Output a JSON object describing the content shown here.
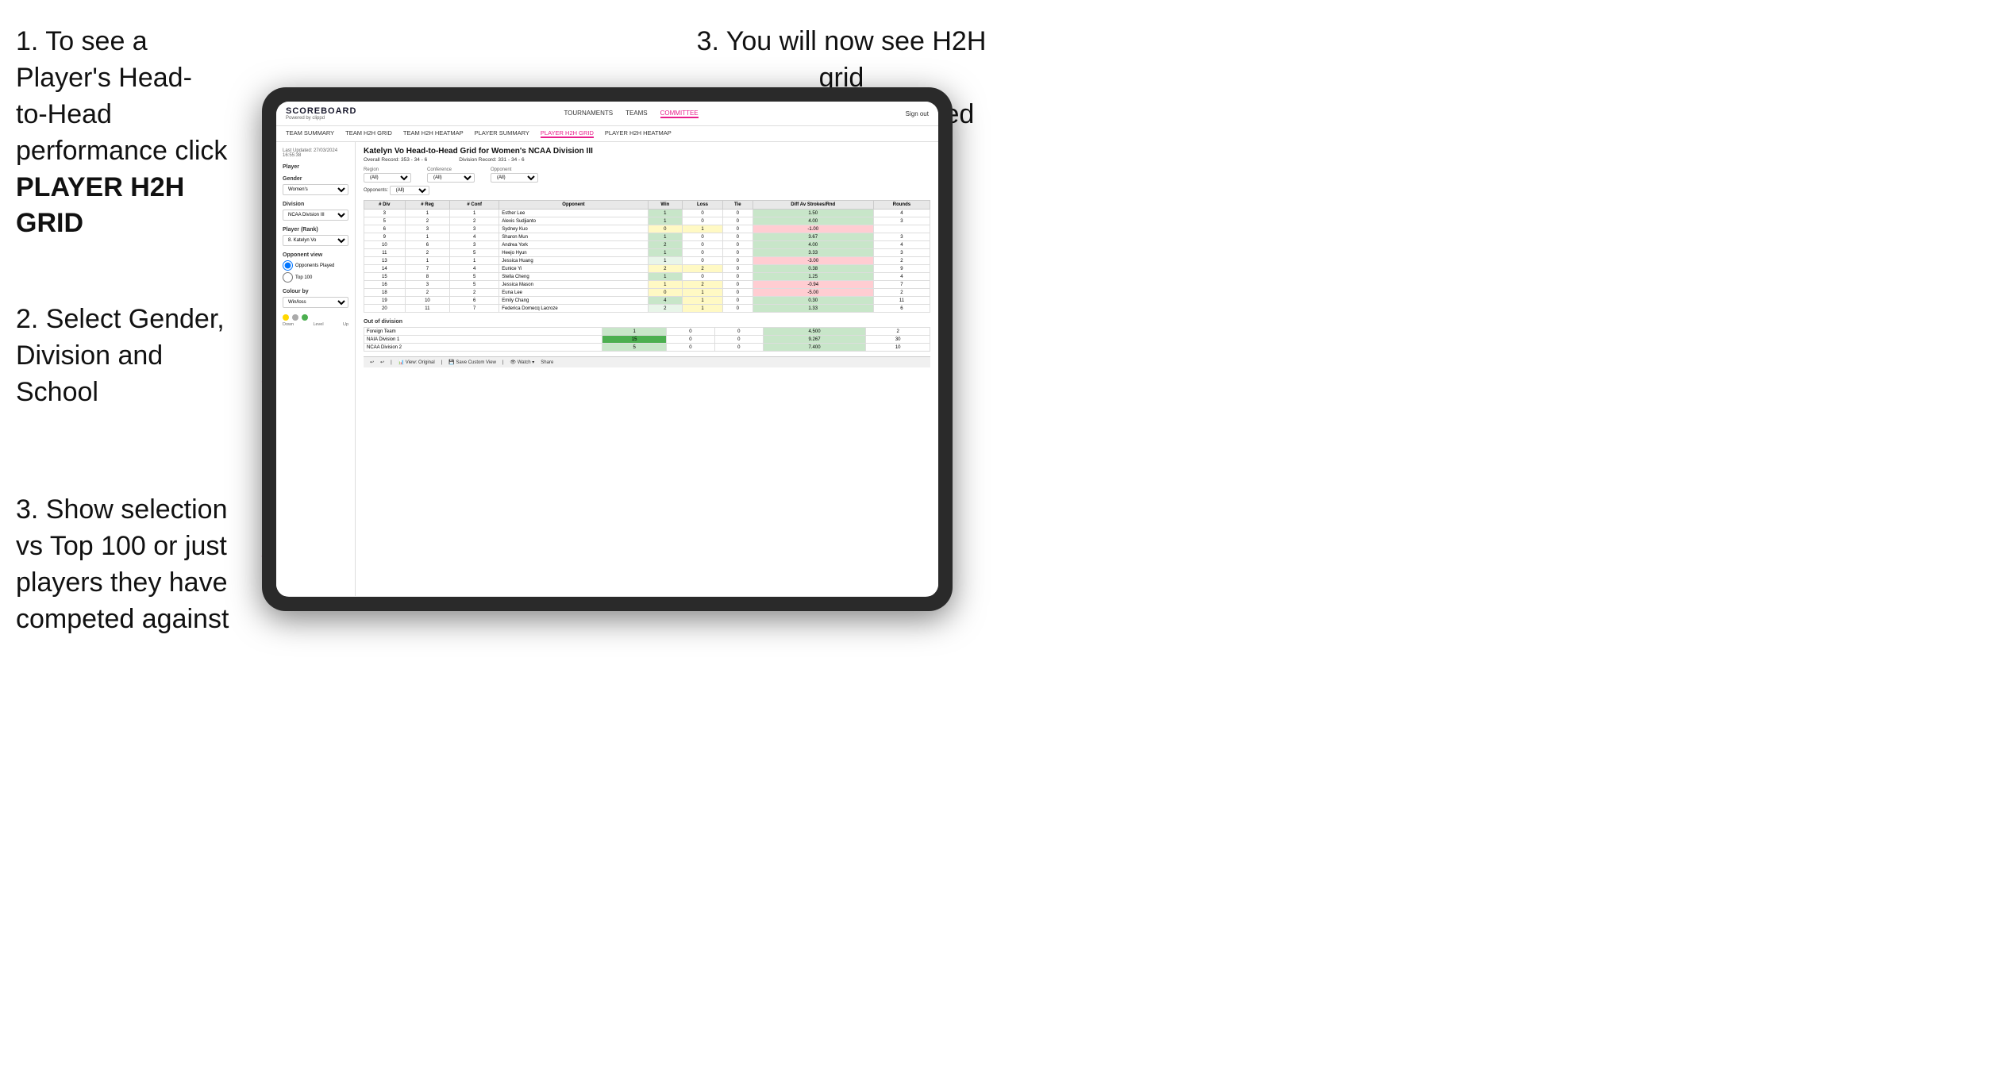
{
  "instructions": {
    "instr1_line1": "1. To see a Player's Head-",
    "instr1_line2": "to-Head performance click",
    "instr1_bold": "PLAYER H2H GRID",
    "instr2_line1": "2. Select Gender,",
    "instr2_line2": "Division and",
    "instr2_line3": "School",
    "instr3_left_line1": "3. Show selection",
    "instr3_left_line2": "vs Top 100 or just",
    "instr3_left_line3": "players they have",
    "instr3_left_line4": "competed against",
    "instr3_top_line1": "3. You will now see H2H grid",
    "instr3_top_line2": "for the player selected"
  },
  "navbar": {
    "brand": "SCOREBOARD",
    "brand_sub": "Powered by clippd",
    "tournaments": "TOURNAMENTS",
    "teams": "TEAMS",
    "committee": "COMMITTEE",
    "sign_out": "Sign out"
  },
  "subnav": {
    "team_summary": "TEAM SUMMARY",
    "team_h2h_grid": "TEAM H2H GRID",
    "team_h2h_heatmap": "TEAM H2H HEATMAP",
    "player_summary": "PLAYER SUMMARY",
    "player_h2h_grid": "PLAYER H2H GRID",
    "player_h2h_heatmap": "PLAYER H2H HEATMAP"
  },
  "left_panel": {
    "last_updated": "Last Updated: 27/03/2024",
    "time": "16:55:38",
    "player_label": "Player",
    "gender_label": "Gender",
    "gender_value": "Women's",
    "division_label": "Division",
    "division_value": "NCAA Division III",
    "player_rank_label": "Player (Rank)",
    "player_rank_value": "8. Katelyn Vo",
    "opponent_view_label": "Opponent view",
    "opponents_played": "Opponents Played",
    "top_100": "Top 100",
    "colour_by_label": "Colour by",
    "colour_by_value": "Win/loss",
    "legend_down": "Down",
    "legend_level": "Level",
    "legend_up": "Up"
  },
  "grid": {
    "title": "Katelyn Vo Head-to-Head Grid for Women's NCAA Division III",
    "overall_record": "Overall Record: 353 - 34 - 6",
    "division_record": "Division Record: 331 - 34 - 6",
    "region_label": "Region",
    "conference_label": "Conference",
    "opponent_label": "Opponent",
    "opponents_label": "Opponents:",
    "all": "(All)",
    "col_div": "# Div",
    "col_reg": "# Reg",
    "col_conf": "# Conf",
    "col_opponent": "Opponent",
    "col_win": "Win",
    "col_loss": "Loss",
    "col_tie": "Tie",
    "col_diff": "Diff Av Strokes/Rnd",
    "col_rounds": "Rounds"
  },
  "table_rows": [
    {
      "div": 3,
      "reg": 1,
      "conf": 1,
      "opponent": "Esther Lee",
      "win": 1,
      "loss": 0,
      "tie": 0,
      "diff": 1.5,
      "rounds": 4,
      "win_color": "green"
    },
    {
      "div": 5,
      "reg": 2,
      "conf": 2,
      "opponent": "Alexis Sudjianto",
      "win": 1,
      "loss": 0,
      "tie": 0,
      "diff": 4.0,
      "rounds": 3,
      "win_color": "green"
    },
    {
      "div": 6,
      "reg": 3,
      "conf": 3,
      "opponent": "Sydney Kuo",
      "win": 0,
      "loss": 1,
      "tie": 0,
      "diff": -1.0,
      "rounds": "",
      "win_color": "yellow"
    },
    {
      "div": 9,
      "reg": 1,
      "conf": 4,
      "opponent": "Sharon Mun",
      "win": 1,
      "loss": 0,
      "tie": 0,
      "diff": 3.67,
      "rounds": 3,
      "win_color": "green"
    },
    {
      "div": 10,
      "reg": 6,
      "conf": 3,
      "opponent": "Andrea York",
      "win": 2,
      "loss": 0,
      "tie": 0,
      "diff": 4.0,
      "rounds": 4,
      "win_color": "green"
    },
    {
      "div": 11,
      "reg": 2,
      "conf": 5,
      "opponent": "Heejo Hyun",
      "win": 1,
      "loss": 0,
      "tie": 0,
      "diff": 3.33,
      "rounds": 3,
      "win_color": "green"
    },
    {
      "div": 13,
      "reg": 1,
      "conf": 1,
      "opponent": "Jessica Huang",
      "win": 1,
      "loss": 0,
      "tie": 0,
      "diff": -3.0,
      "rounds": 2,
      "win_color": "light_green"
    },
    {
      "div": 14,
      "reg": 7,
      "conf": 4,
      "opponent": "Eunice Yi",
      "win": 2,
      "loss": 2,
      "tie": 0,
      "diff": 0.38,
      "rounds": 9,
      "win_color": "yellow"
    },
    {
      "div": 15,
      "reg": 8,
      "conf": 5,
      "opponent": "Stella Cheng",
      "win": 1,
      "loss": 0,
      "tie": 0,
      "diff": 1.25,
      "rounds": 4,
      "win_color": "green"
    },
    {
      "div": 16,
      "reg": 3,
      "conf": 5,
      "opponent": "Jessica Mason",
      "win": 1,
      "loss": 2,
      "tie": 0,
      "diff": -0.94,
      "rounds": 7,
      "win_color": "yellow"
    },
    {
      "div": 18,
      "reg": 2,
      "conf": 2,
      "opponent": "Euna Lee",
      "win": 0,
      "loss": 1,
      "tie": 0,
      "diff": -5.0,
      "rounds": 2,
      "win_color": "yellow"
    },
    {
      "div": 19,
      "reg": 10,
      "conf": 6,
      "opponent": "Emily Chang",
      "win": 4,
      "loss": 1,
      "tie": 0,
      "diff": 0.3,
      "rounds": 11,
      "win_color": "green"
    },
    {
      "div": 20,
      "reg": 11,
      "conf": 7,
      "opponent": "Federica Domecq Lacroze",
      "win": 2,
      "loss": 1,
      "tie": 0,
      "diff": 1.33,
      "rounds": 6,
      "win_color": "light_green"
    }
  ],
  "out_of_division": {
    "title": "Out of division",
    "rows": [
      {
        "name": "Foreign Team",
        "win": 1,
        "loss": 0,
        "tie": 0,
        "diff": 4.5,
        "rounds": 2,
        "win_color": "green"
      },
      {
        "name": "NAIA Division 1",
        "win": 15,
        "loss": 0,
        "tie": 0,
        "diff": 9.267,
        "rounds": 30,
        "win_color": "dark_green"
      },
      {
        "name": "NCAA Division 2",
        "win": 5,
        "loss": 0,
        "tie": 0,
        "diff": 7.4,
        "rounds": 10,
        "win_color": "green"
      }
    ]
  },
  "toolbar": {
    "undo": "↩",
    "redo": "↪",
    "view_original": "View: Original",
    "save_custom": "Save Custom View",
    "watch": "Watch ▾",
    "share": "Share"
  }
}
